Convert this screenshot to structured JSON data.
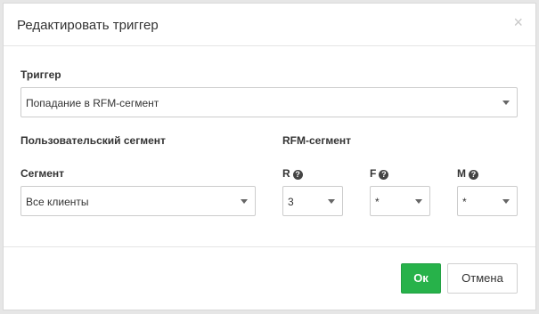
{
  "dialog": {
    "title": "Редактировать триггер",
    "close_glyph": "×"
  },
  "trigger": {
    "label": "Триггер",
    "value": "Попадание в RFM-сегмент"
  },
  "user_segment": {
    "section_title": "Пользовательский сегмент",
    "label": "Сегмент",
    "value": "Все клиенты"
  },
  "rfm_segment": {
    "section_title": "RFM-сегмент",
    "r": {
      "label": "R",
      "value": "3"
    },
    "f": {
      "label": "F",
      "value": "*"
    },
    "m": {
      "label": "M",
      "value": "*"
    },
    "help_glyph": "?"
  },
  "footer": {
    "ok_label": "Ок",
    "cancel_label": "Отмена"
  },
  "colors": {
    "ok_button": "#27b24a",
    "backdrop": "#e6e6e6"
  },
  "icons": [
    "close-icon",
    "chevron-down-icon",
    "help-icon"
  ]
}
